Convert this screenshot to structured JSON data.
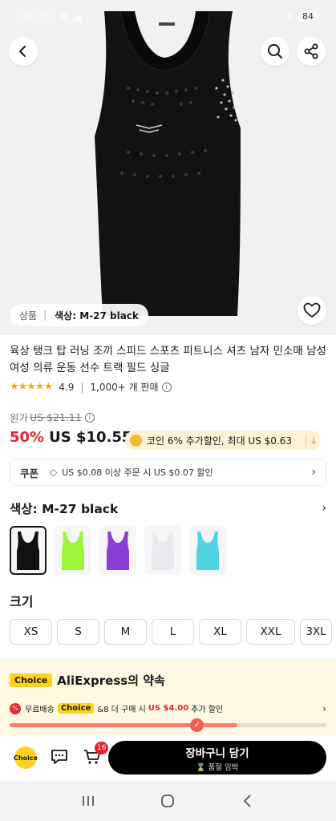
{
  "status_bar": {
    "time": "10:09",
    "battery": "84"
  },
  "product": {
    "variant_chip": {
      "prefix": "상품",
      "color_label": "색상: M-27 black"
    },
    "title": "육상 탱크 탑 러닝 조끼 스피드 스포츠 피트니스 셔츠 남자 민소매 남성 여성 의류 운동 선수 트랙 필드 싱글",
    "rating": "4.9",
    "sold": "1,000+ 개 판매",
    "original_price_label": "원가",
    "original_price": "US $21.11",
    "discount": "50%",
    "price": "US $10.55",
    "coin_offer": "코인 6% 추가할인, 최대 US $0.63"
  },
  "coupon": {
    "label": "쿠폰",
    "text": "US $0.08 이상 주문 시 US $0.07 할인"
  },
  "color": {
    "heading": "색상: M-27 black",
    "swatches": [
      {
        "name": "black",
        "color": "#111111"
      },
      {
        "name": "lime",
        "color": "#9cf53a"
      },
      {
        "name": "purple",
        "color": "#8a3fd6"
      },
      {
        "name": "white",
        "color": "#e9e9ef"
      },
      {
        "name": "cyan",
        "color": "#4fd3e0"
      }
    ]
  },
  "size": {
    "heading": "크기",
    "options": [
      "XS",
      "S",
      "M",
      "L",
      "XL",
      "XXL",
      "3XL"
    ]
  },
  "promise": {
    "badge": "Choice",
    "title": "AliExpress의 약속",
    "shipping_prefix": "무료배송",
    "shipping_badge": "Choice",
    "shipping_mid": "&8 더 구매 시",
    "shipping_amount": "US $4.00",
    "shipping_suffix": "추가 할인",
    "progress": 0.72
  },
  "bottom_bar": {
    "choice_label": "Choice",
    "cart_count": "16",
    "add_to_cart": "장바구니 담기",
    "add_to_cart_sub": "품절 임박"
  },
  "colors": {
    "accent": "#e8232f",
    "choice_yellow": "#ffd21f"
  }
}
